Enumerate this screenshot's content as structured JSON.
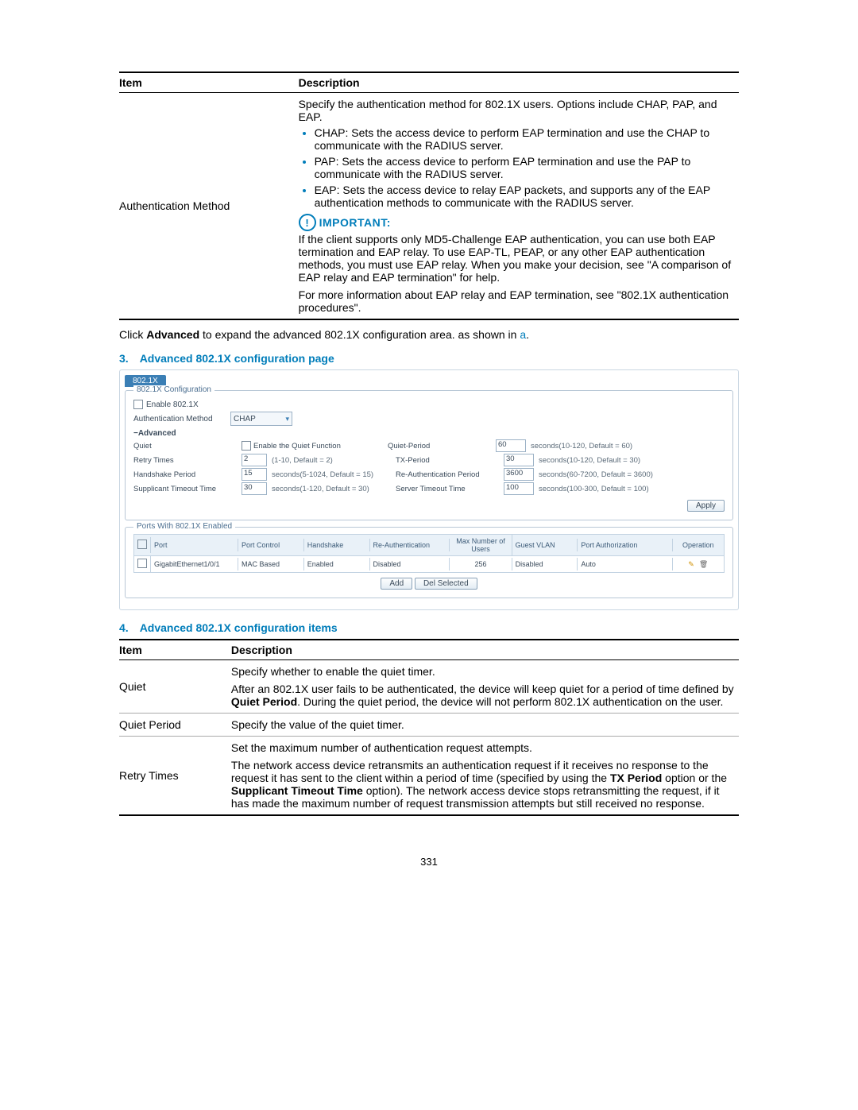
{
  "table1": {
    "head_item": "Item",
    "head_desc": "Description",
    "row_item": "Authentication Method",
    "intro": "Specify the authentication method for 802.1X users. Options include CHAP, PAP, and EAP.",
    "bullets": [
      "CHAP: Sets the access device to perform EAP termination and use the CHAP to communicate with the RADIUS server.",
      "PAP: Sets the access device to perform EAP termination and use the PAP to communicate with the RADIUS server.",
      "EAP: Sets the access device to relay EAP packets, and supports any of the EAP authentication methods to communicate with the RADIUS server."
    ],
    "important_label": "IMPORTANT:",
    "important_p1": "If the client supports only MD5-Challenge EAP authentication, you can use both EAP termination and EAP relay. To use EAP-TL, PEAP, or any other EAP authentication methods, you must use EAP relay. When you make your decision, see \"A comparison of EAP relay and EAP termination\" for help.",
    "important_p2": "For more information about EAP relay and EAP termination, see \"802.1X authentication procedures\"."
  },
  "mid_para": {
    "pre": "Click ",
    "bold": "Advanced",
    "post": " to expand the advanced 802.1X configuration area. as shown in ",
    "link": "a",
    "end": "."
  },
  "sec3": {
    "num": "3.",
    "title": "Advanced 802.1X configuration page"
  },
  "fig": {
    "tab": "802.1X",
    "panel1_title": "802.1X Configuration",
    "enable_label": "Enable 802.1X",
    "auth_label": "Authentication Method",
    "auth_value": "CHAP",
    "adv_toggle": "−Advanced",
    "rows": [
      {
        "l1": "Quiet",
        "chk": "Enable the Quiet Function",
        "l2": "Quiet-Period",
        "v2": "60",
        "h2": "seconds(10-120, Default = 60)"
      },
      {
        "l1": "Retry Times",
        "v1": "2",
        "h1": "(1-10, Default = 2)",
        "l2": "TX-Period",
        "v2": "30",
        "h2": "seconds(10-120, Default = 30)"
      },
      {
        "l1": "Handshake Period",
        "v1": "15",
        "h1": "seconds(5-1024, Default = 15)",
        "l2": "Re-Authentication Period",
        "v2": "3600",
        "h2": "seconds(60-7200, Default = 3600)"
      },
      {
        "l1": "Supplicant Timeout Time",
        "v1": "30",
        "h1": "seconds(1-120, Default = 30)",
        "l2": "Server Timeout Time",
        "v2": "100",
        "h2": "seconds(100-300, Default = 100)"
      }
    ],
    "apply": "Apply",
    "panel2_title": "Ports With 802.1X Enabled",
    "ph": [
      "Port",
      "Port Control",
      "Handshake",
      "Re-Authentication",
      "Max Number of Users",
      "Guest VLAN",
      "Port Authorization",
      "Operation"
    ],
    "prow": [
      "GigabitEthernet1/0/1",
      "MAC Based",
      "Enabled",
      "Disabled",
      "256",
      "Disabled",
      "Auto"
    ],
    "btn_add": "Add",
    "btn_del": "Del Selected"
  },
  "sec4": {
    "num": "4.",
    "title": "Advanced 802.1X configuration items"
  },
  "table2": {
    "head_item": "Item",
    "head_desc": "Description",
    "rows": [
      {
        "item": "Quiet",
        "p1": "Specify whether to enable the quiet timer.",
        "p2a": "After an 802.1X user fails to be authenticated, the device will keep quiet for a period of time defined by ",
        "b1": "Quiet Period",
        "p2b": ". During the quiet period, the device will not perform 802.1X authentication on the user."
      },
      {
        "item": "Quiet Period",
        "p1": "Specify the value of the quiet timer."
      },
      {
        "item": "Retry Times",
        "p1": "Set the maximum number of authentication request attempts.",
        "p2a": "The network access device retransmits an authentication request if it receives no response to the request it has sent to the client within a period of time (specified by using the ",
        "b1": "TX Period",
        "p2b": " option or the ",
        "b2": "Supplicant Timeout Time",
        "p2c": " option). The network access device stops retransmitting the request, if it has made the maximum number of request transmission attempts but still received no response."
      }
    ]
  },
  "page_num": "331"
}
